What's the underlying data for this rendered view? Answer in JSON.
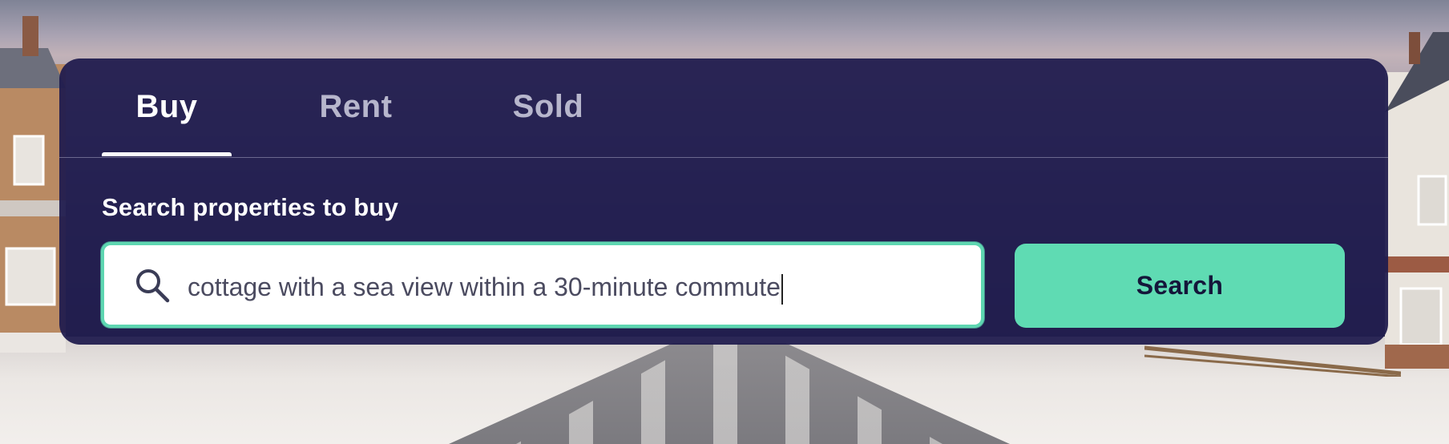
{
  "tabs": [
    {
      "label": "Buy",
      "active": true
    },
    {
      "label": "Rent",
      "active": false
    },
    {
      "label": "Sold",
      "active": false
    }
  ],
  "search": {
    "heading": "Search properties to buy",
    "value": "cottage with a sea view within a 30-minute commute",
    "icon": "search-icon",
    "button_label": "Search"
  },
  "colors": {
    "panel": "#201c4e",
    "accent": "#5fdbb3",
    "tab_inactive": "#b7b6cc"
  }
}
